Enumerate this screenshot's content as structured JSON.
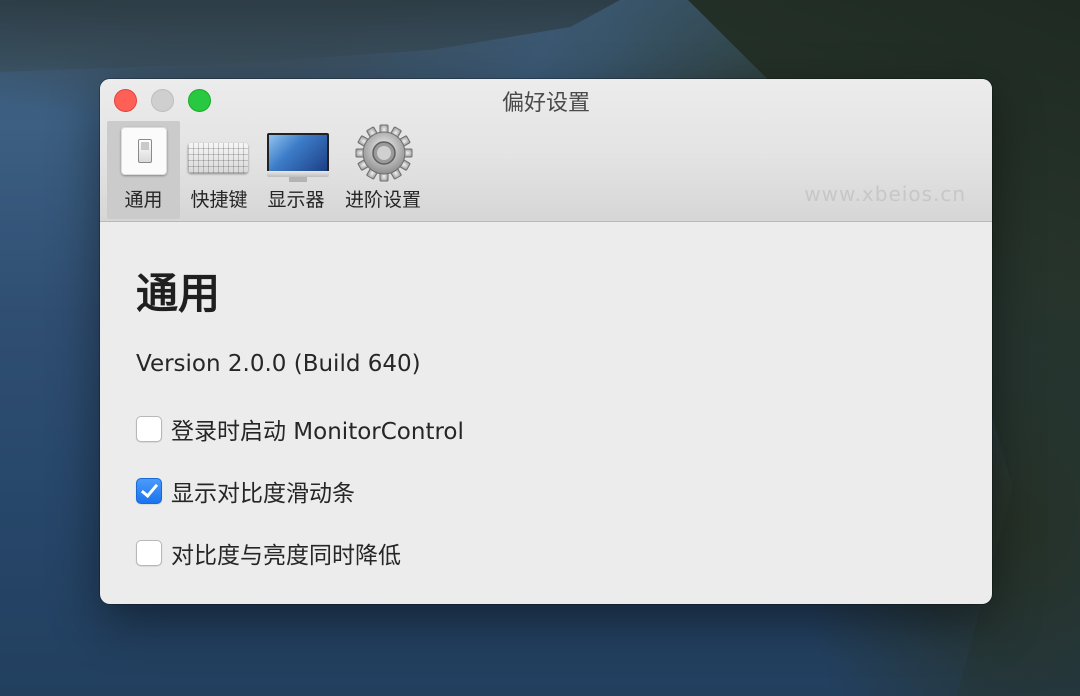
{
  "window": {
    "title": "偏好设置"
  },
  "toolbar": {
    "items": [
      {
        "label": "通用",
        "icon": "switch-panel-icon",
        "selected": true
      },
      {
        "label": "快捷键",
        "icon": "keyboard-icon",
        "selected": false
      },
      {
        "label": "显示器",
        "icon": "monitor-icon",
        "selected": false
      },
      {
        "label": "进阶设置",
        "icon": "gear-icon",
        "selected": false
      }
    ]
  },
  "watermark": "www.xbeios.cn",
  "general": {
    "title": "通用",
    "version": "Version 2.0.0 (Build 640)",
    "options": [
      {
        "label": "登录时启动 MonitorControl",
        "checked": false
      },
      {
        "label": "显示对比度滑动条",
        "checked": true
      },
      {
        "label": "对比度与亮度同时降低",
        "checked": false
      }
    ]
  },
  "colors": {
    "accent": "#1a74ee",
    "close": "#fe5f57",
    "zoom": "#28c840"
  }
}
